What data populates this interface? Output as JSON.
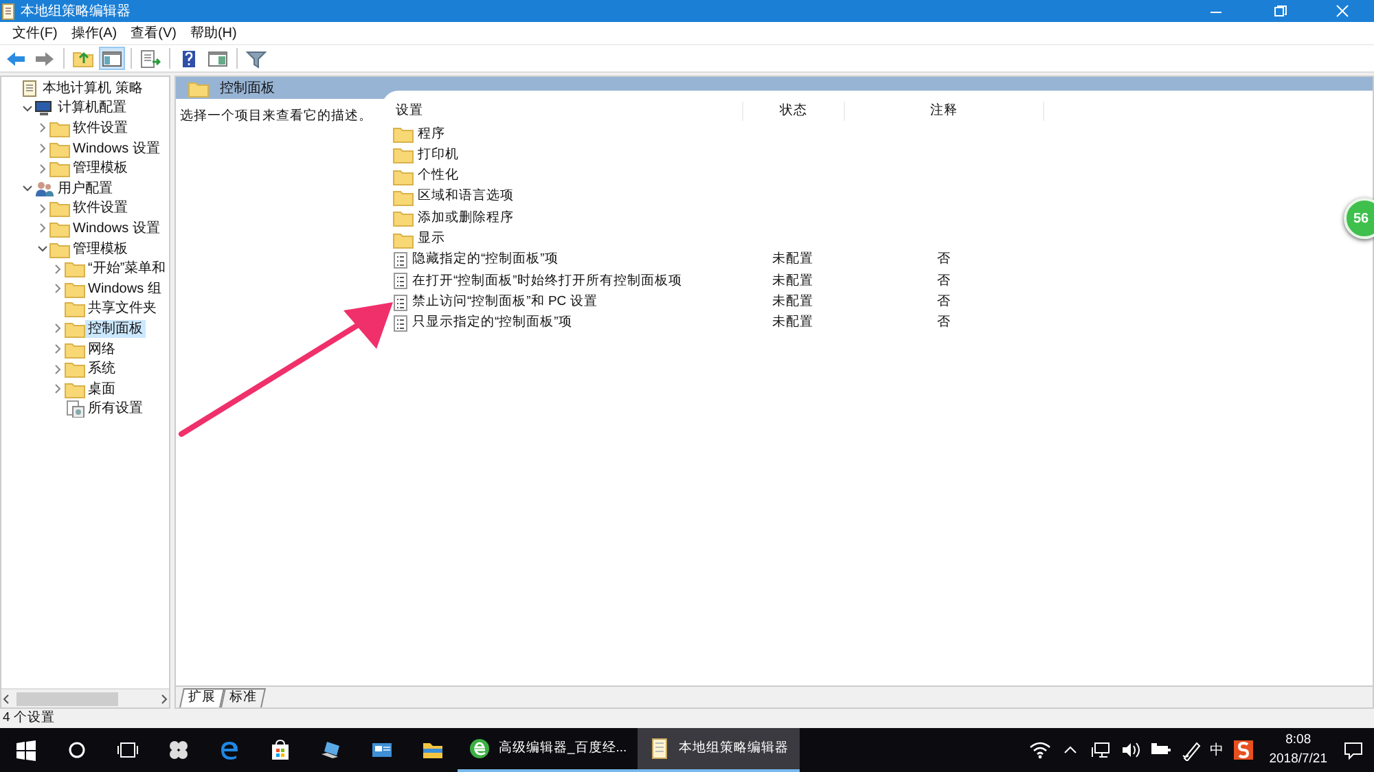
{
  "window": {
    "title": "本地组策略编辑器"
  },
  "menu": [
    "文件(F)",
    "操作(A)",
    "查看(V)",
    "帮助(H)"
  ],
  "toolbar": [
    {
      "kind": "back",
      "pressed": false
    },
    {
      "kind": "forward",
      "pressed": false
    },
    {
      "kind": "up",
      "pressed": false
    },
    {
      "kind": "tree",
      "pressed": true
    },
    {
      "kind": "export",
      "pressed": false
    },
    {
      "kind": "help",
      "pressed": false
    },
    {
      "kind": "view",
      "pressed": false
    },
    {
      "kind": "filter",
      "pressed": false
    }
  ],
  "tree": [
    {
      "label": "本地计算机 策略",
      "kind": "root",
      "selected": false,
      "children": [
        {
          "label": "计算机配置",
          "kind": "computer",
          "expanded": true,
          "selected": false,
          "children": [
            {
              "label": "软件设置",
              "kind": "folder",
              "expanded": false,
              "selected": false
            },
            {
              "label": "Windows 设置",
              "kind": "folder",
              "expanded": false,
              "selected": false
            },
            {
              "label": "管理模板",
              "kind": "folder",
              "expanded": false,
              "selected": false
            }
          ]
        },
        {
          "label": "用户配置",
          "kind": "user",
          "expanded": true,
          "selected": false,
          "children": [
            {
              "label": "软件设置",
              "kind": "folder",
              "expanded": false,
              "selected": false
            },
            {
              "label": "Windows 设置",
              "kind": "folder",
              "expanded": false,
              "selected": false
            },
            {
              "label": "管理模板",
              "kind": "folder",
              "expanded": true,
              "selected": false,
              "children": [
                {
                  "label": "“开始”菜单和",
                  "kind": "folder",
                  "expanded": false,
                  "selected": false
                },
                {
                  "label": "Windows 组",
                  "kind": "folder",
                  "expanded": false,
                  "selected": false
                },
                {
                  "label": "共享文件夹",
                  "kind": "folder",
                  "selected": false
                },
                {
                  "label": "控制面板",
                  "kind": "folder",
                  "expanded": false,
                  "selected": true
                },
                {
                  "label": "网络",
                  "kind": "folder",
                  "expanded": false,
                  "selected": false
                },
                {
                  "label": "系统",
                  "kind": "folder",
                  "expanded": false,
                  "selected": false
                },
                {
                  "label": "桌面",
                  "kind": "folder",
                  "expanded": false,
                  "selected": false
                },
                {
                  "label": "所有设置",
                  "kind": "settings",
                  "selected": false
                }
              ]
            }
          ]
        }
      ]
    }
  ],
  "pane": {
    "title": "控制面板",
    "description": "选择一个项目来查看它的描述。"
  },
  "table": {
    "columns": [
      "设置",
      "状态",
      "注释"
    ],
    "rows": [
      {
        "kind": "folder",
        "name": "程序"
      },
      {
        "kind": "folder",
        "name": "打印机"
      },
      {
        "kind": "folder",
        "name": "个性化"
      },
      {
        "kind": "folder",
        "name": "区域和语言选项"
      },
      {
        "kind": "folder",
        "name": "添加或删除程序"
      },
      {
        "kind": "folder",
        "name": "显示"
      },
      {
        "kind": "policy",
        "name": "隐藏指定的“控制面板”项",
        "state": "未配置",
        "comment": "否"
      },
      {
        "kind": "policy",
        "name": "在打开“控制面板”时始终打开所有控制面板项",
        "state": "未配置",
        "comment": "否"
      },
      {
        "kind": "policy",
        "name": "禁止访问“控制面板”和 PC 设置",
        "state": "未配置",
        "comment": "否"
      },
      {
        "kind": "policy",
        "name": "只显示指定的“控制面板”项",
        "state": "未配置",
        "comment": "否"
      }
    ]
  },
  "bottom_tabs": [
    {
      "label": "扩展",
      "selected": true
    },
    {
      "label": "标准",
      "selected": false
    }
  ],
  "status_bar": "4 个设置",
  "floating_badge": "56",
  "taskbar": {
    "pinned": [
      {
        "kind": "start"
      },
      {
        "kind": "search"
      },
      {
        "kind": "taskview"
      },
      {
        "kind": "fan"
      },
      {
        "kind": "edge"
      },
      {
        "kind": "store"
      },
      {
        "kind": "laptop"
      },
      {
        "kind": "app"
      },
      {
        "kind": "explorer"
      }
    ],
    "tasks": [
      {
        "label": "高级编辑器_百度经...",
        "kind": "browser",
        "selected": false
      },
      {
        "label": "本地组策略编辑器",
        "kind": "scroll",
        "selected": true
      }
    ],
    "tray": [
      {
        "kind": "wifi"
      },
      {
        "kind": "chevron"
      },
      {
        "kind": "network"
      },
      {
        "kind": "volume"
      },
      {
        "kind": "battery"
      },
      {
        "kind": "pen"
      },
      {
        "kind": "text",
        "label": "中"
      },
      {
        "kind": "sogou"
      }
    ],
    "time": "8:08",
    "date": "2018/7/21"
  }
}
